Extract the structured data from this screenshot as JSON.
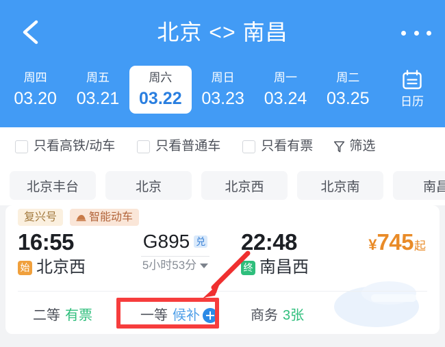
{
  "header": {
    "title": "北京 <> 南昌",
    "back_icon": "chevron-left-icon",
    "more_icon": "more-dots-icon",
    "accent_color": "#429bf5",
    "calendar": {
      "icon": "calendar-icon",
      "label": "日历"
    },
    "dates": [
      {
        "dow": "周四",
        "date": "03.20",
        "active": false
      },
      {
        "dow": "周五",
        "date": "03.21",
        "active": false
      },
      {
        "dow": "周六",
        "date": "03.22",
        "active": true
      },
      {
        "dow": "周日",
        "date": "03.23",
        "active": false
      },
      {
        "dow": "周一",
        "date": "03.24",
        "active": false
      },
      {
        "dow": "周二",
        "date": "03.25",
        "active": false
      }
    ]
  },
  "filters": {
    "checkboxes": [
      {
        "label": "只看高铁/动车",
        "checked": false
      },
      {
        "label": "只看普通车",
        "checked": false
      },
      {
        "label": "只看有票",
        "checked": false
      }
    ],
    "filter_button": {
      "label": "筛选",
      "icon": "funnel-icon"
    }
  },
  "station_chips": [
    {
      "label": "北京丰台"
    },
    {
      "label": "北京"
    },
    {
      "label": "北京西"
    },
    {
      "label": "北京南"
    },
    {
      "label": "南昌"
    }
  ],
  "train_card": {
    "tags": [
      {
        "label": "复兴号",
        "icon": null
      },
      {
        "label": "智能动车",
        "icon": "train-icon"
      }
    ],
    "depart_time": "16:55",
    "arrive_time": "22:48",
    "train_no": "G895",
    "exchange_badge": "兑",
    "duration": "5小时53分",
    "duration_caret": "chevron-down-icon",
    "depart_station": {
      "badge": "始",
      "name": "北京西",
      "badge_color": "#f0a03c"
    },
    "arrive_station": {
      "badge": "终",
      "name": "南昌西",
      "badge_color": "#2fbe7c"
    },
    "price": {
      "currency": "¥",
      "amount": "745",
      "suffix": "起",
      "color": "#e98b28"
    },
    "seats": [
      {
        "name": "二等",
        "value": "有票",
        "value_color": "green",
        "has_plus": false,
        "highlighted": false
      },
      {
        "name": "一等",
        "value": "候补",
        "value_color": "blue",
        "has_plus": true,
        "highlighted": true
      },
      {
        "name": "商务",
        "value": "3张",
        "value_color": "green",
        "has_plus": false,
        "highlighted": false
      }
    ]
  },
  "annotations": {
    "highlight_color": "#f63d3d",
    "arrow": "red-arrow-pointing-down-left",
    "box_target": "一等 候补"
  }
}
